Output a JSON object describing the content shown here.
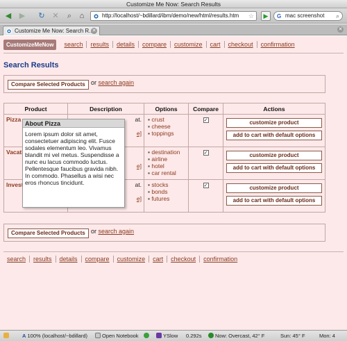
{
  "window": {
    "title": "Customize Me Now: Search Results"
  },
  "toolbar": {
    "back_icon": "◀",
    "forward_icon": "▶",
    "reload_icon": "↻",
    "stop_icon": "✕",
    "zoom_icon": "⌕",
    "home_icon": "⌂",
    "url": "http://localhost/~bdillard/ibm/demo/new/html/results.htm",
    "go_icon": "▶",
    "search_value": "mac screenshot",
    "search_engine_glyph": "G"
  },
  "tab": {
    "label": "Customize Me Now: Search R..."
  },
  "brand": "CustomizeMeNow",
  "nav": [
    "search",
    "results",
    "details",
    "compare",
    "customize",
    "cart",
    "checkout",
    "confirmation"
  ],
  "page_title": "Search Results",
  "compare": {
    "button": "Compare Selected Products",
    "or_text": "or",
    "link": "search again"
  },
  "table": {
    "headers": [
      "Product",
      "Description",
      "Options",
      "Compare",
      "Actions"
    ],
    "rows": [
      {
        "product": "Pizza",
        "desc_text": "at.",
        "desc_link": "e]",
        "options": [
          "crust",
          "cheese",
          "toppings"
        ],
        "checked": "✓",
        "actions": [
          "customize product",
          "add to cart with default options"
        ]
      },
      {
        "product": "Vacati",
        "desc_text": "",
        "desc_link": "e]",
        "options": [
          "destination",
          "airline",
          "hotel",
          "car rental"
        ],
        "checked": "✓",
        "actions": [
          "customize product",
          "add to cart with default options"
        ]
      },
      {
        "product": "Invest",
        "desc_text": "at.",
        "desc_link": "e]",
        "options": [
          "stocks",
          "bonds",
          "futures"
        ],
        "checked": "✓",
        "actions": [
          "customize product",
          "add to cart with default options"
        ]
      }
    ]
  },
  "popup": {
    "title": "About Pizza",
    "body": "Lorem ipsum dolor sit amet, consectetuer adipiscing elit. Fusce sodales elementum leo. Vivamus blandit mi vel metus. Suspendisse a nunc eu lacus commodo luctus. Pellentesque faucibus gravida nibh. In commodo. Phasellus a wisi nec eros rhoncus tincidunt."
  },
  "status": {
    "zoom": "100% (localhost/~bdillard)",
    "notebook": "Open Notebook",
    "yslow": "YSlow",
    "time": "0.292s",
    "weather": "Now: Overcast, 42° F",
    "sun": "Sun: 45° F",
    "mon": "Mon: 4"
  }
}
